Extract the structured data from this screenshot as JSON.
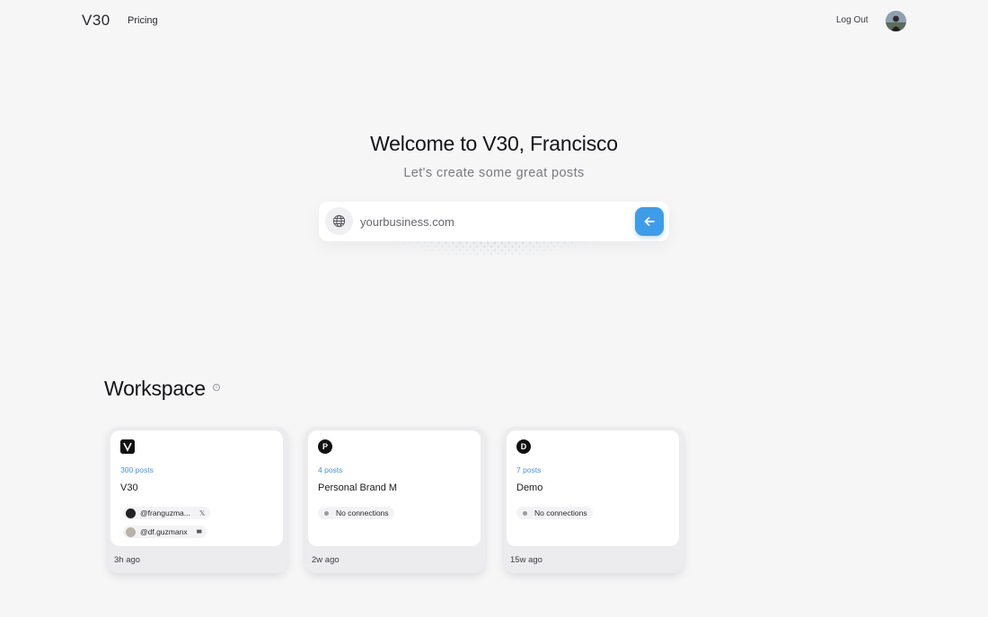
{
  "header": {
    "brand": "V30",
    "nav_pricing": "Pricing",
    "logout": "Log Out",
    "avatar_icon": "user-avatar"
  },
  "hero": {
    "title": "Welcome to V30, Francisco",
    "subtitle": "Let's create some great posts"
  },
  "search": {
    "placeholder": "yourbusiness.com",
    "value": "",
    "icon": "globe-icon",
    "submit_icon": "arrow-left-icon",
    "submit_color": "#3f9ce8"
  },
  "workspace": {
    "title": "Workspace",
    "info_icon": "info-icon",
    "cards": [
      {
        "logo": "",
        "logo_icon": "v30-logo",
        "count": "300 posts",
        "name": "V30",
        "connections": [
          {
            "handle": "@franguzma...",
            "platform_icon": "x-icon",
            "platform_mark": "𝕏"
          },
          {
            "handle": "@df.guzmanx",
            "platform_icon": "bar-chart-icon",
            "platform_mark": "▮▮▮"
          }
        ],
        "time": "3h ago"
      },
      {
        "logo": "P",
        "count": "4 posts",
        "name": "Personal Brand M",
        "no_connections": "No connections",
        "time": "2w ago"
      },
      {
        "logo": "D",
        "count": "7 posts",
        "name": "Demo",
        "no_connections": "No connections",
        "time": "15w ago"
      }
    ]
  },
  "colors": {
    "background": "#f6f6f7",
    "accent": "#3f9ce8",
    "post_count": "#4a8fdc"
  }
}
